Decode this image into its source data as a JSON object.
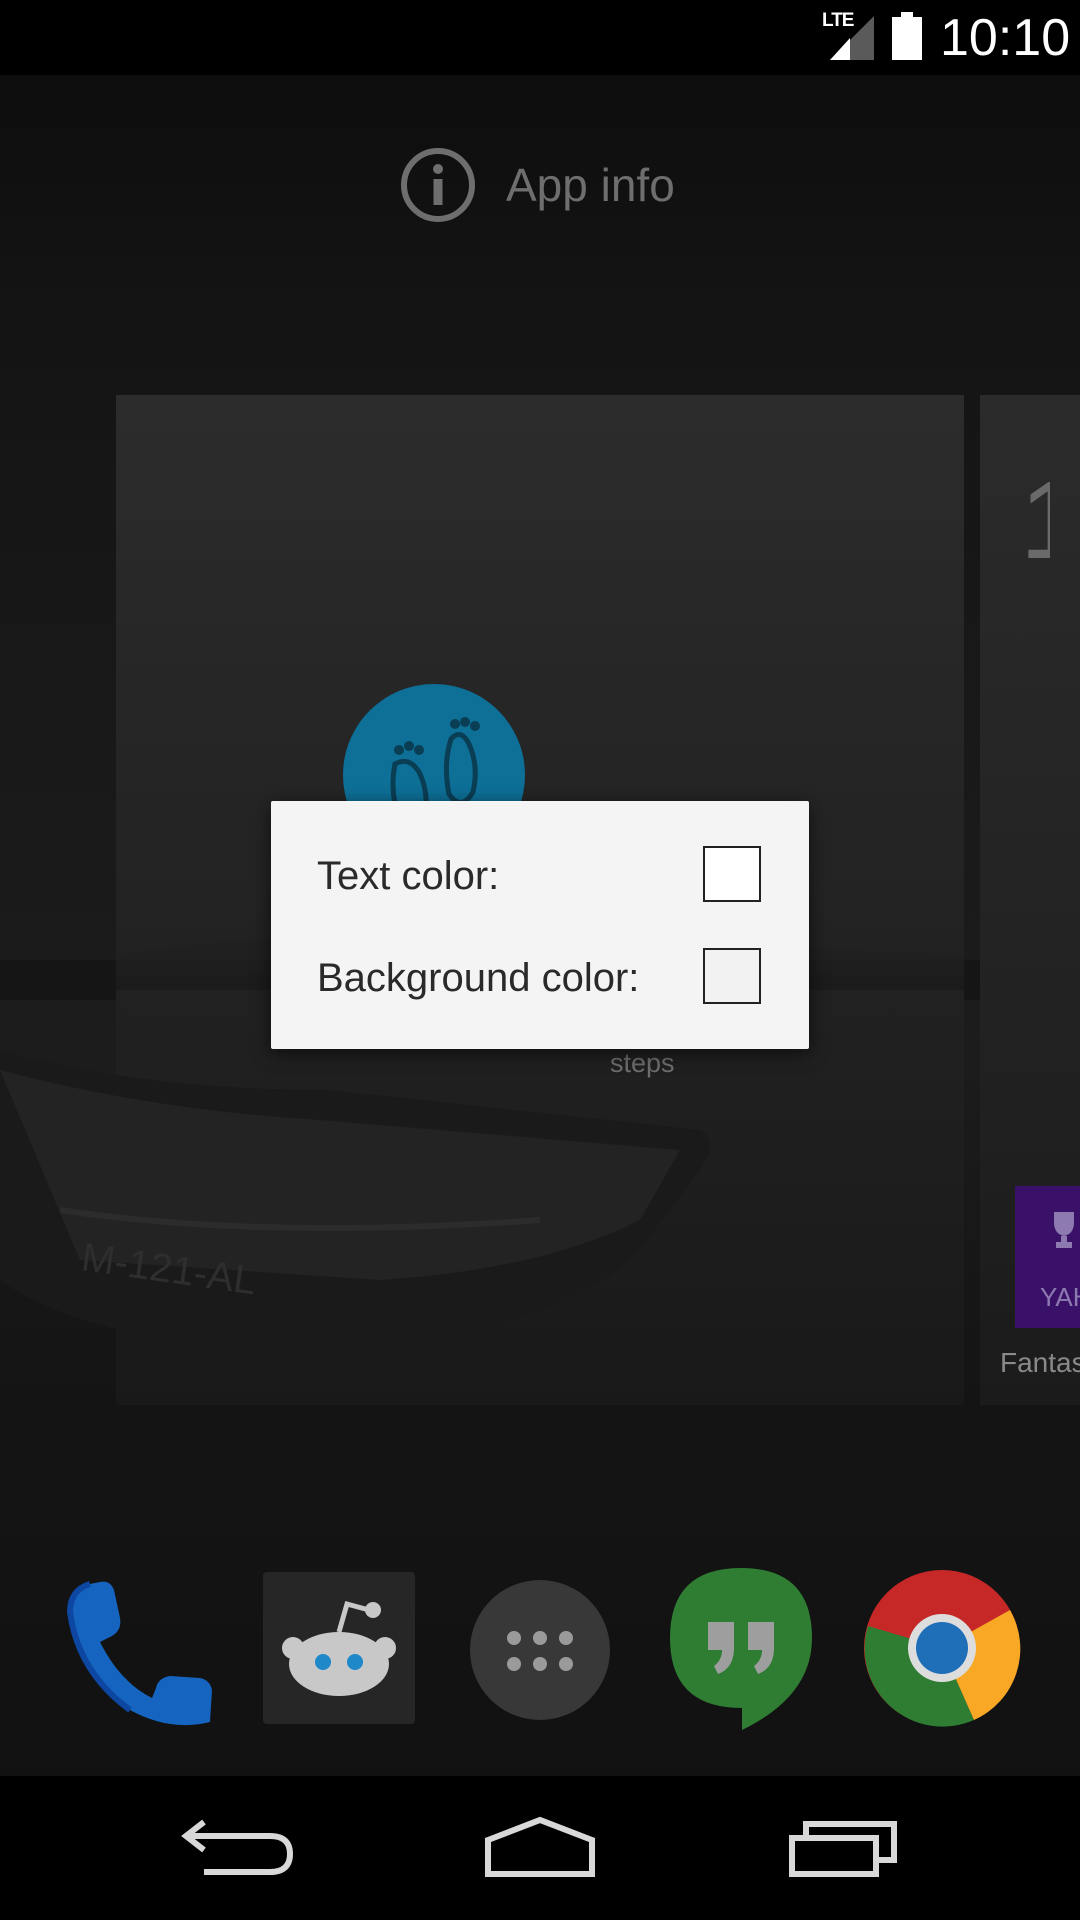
{
  "status_bar": {
    "network_label": "LTE",
    "time": "10:10",
    "icons": [
      "lte-signal-icon",
      "battery-icon"
    ]
  },
  "drop_target": {
    "label": "App info",
    "icon": "info-icon"
  },
  "home_screen": {
    "steps_widget_label": "steps",
    "right_page_app_label": "Fantas",
    "right_page_tile_text": "YAH",
    "right_page_digit": "1"
  },
  "dialog": {
    "text_color_label": "Text color:",
    "background_color_label": "Background color:",
    "text_color_value": "#ffffff",
    "background_color_value": "#f2f2f2"
  },
  "dock": {
    "items": [
      "phone-icon",
      "reddit-icon",
      "app-drawer-icon",
      "hangouts-icon",
      "chrome-icon"
    ]
  },
  "nav_bar": {
    "items": [
      "back-icon",
      "home-icon",
      "recents-icon"
    ]
  },
  "colors": {
    "steps_blue": "#0e6f97",
    "yahoo_purple": "#3a1168",
    "phone_blue": "#1565c0",
    "hangouts_green": "#2e7d32"
  }
}
